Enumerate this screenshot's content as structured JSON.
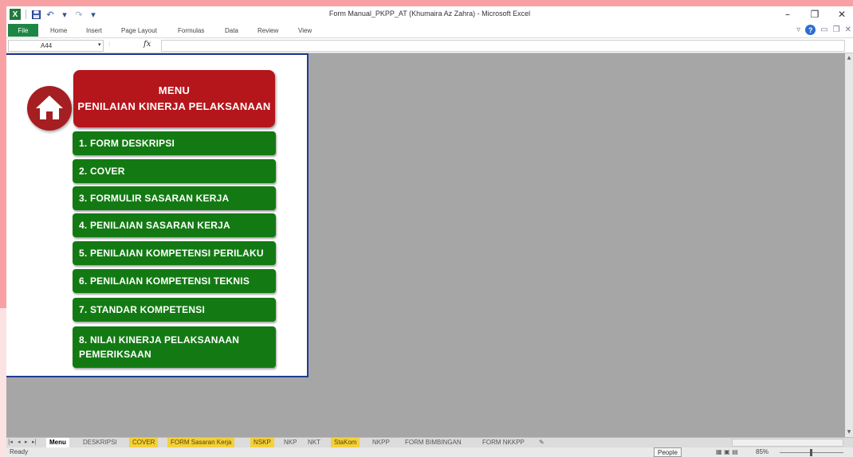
{
  "window": {
    "title": "Form Manual_PKPP_AT (Khumaira Az Zahra)  -  Microsoft Excel"
  },
  "quick_access": {
    "app_icon": "X",
    "save_icon": "save-icon",
    "undo_glyph": "↶",
    "redo_glyph": "↷",
    "customize_glyph": "▾"
  },
  "window_controls": {
    "minimize": "–",
    "restore": "❐",
    "close": "✕"
  },
  "ribbon": {
    "file_label": "File",
    "tabs": [
      "Home",
      "Insert",
      "Page Layout",
      "Formulas",
      "Data",
      "Review",
      "View"
    ],
    "help_glyph": "?"
  },
  "formula_bar": {
    "name_box": "A44",
    "fx": "fx",
    "formula": ""
  },
  "menu": {
    "title_line1": "MENU",
    "title_line2": "PENILAIAN KINERJA PELAKSANAAN",
    "buttons": [
      "1. FORM DESKRIPSI",
      "2. COVER",
      "3. FORMULIR SASARAN KERJA",
      "4. PENILAIAN SASARAN KERJA",
      "5. PENILAIAN KOMPETENSI  PERILAKU",
      "6. PENILAIAN KOMPETENSI TEKNIS",
      "7. STANDAR KOMPETENSI"
    ],
    "button8_line1": "8. NILAI KINERJA PELAKSANAAN",
    "button8_line2": "PEMERIKSAAN"
  },
  "sheet_tabs": {
    "nav": [
      "|◂",
      "◂",
      "▸",
      "▸|"
    ],
    "tabs": [
      "Menu",
      "DESKRIPSI",
      "COVER",
      "FORM Sasaran Kerja",
      "NSKP",
      "NKP",
      "NKT",
      "StaKom",
      "NKPP",
      "FORM BIMBINGAN",
      "FORM NKKPP"
    ]
  },
  "status_bar": {
    "ready": "Ready",
    "people": "People",
    "zoom": "85%"
  },
  "colors": {
    "menu_red": "#b4161b",
    "button_green": "#137a13",
    "panel_border": "#233a8f",
    "file_tab": "#1e8645",
    "active_sheet_tab": "#ffffff",
    "highlighted_tab": "#f4d03a"
  }
}
